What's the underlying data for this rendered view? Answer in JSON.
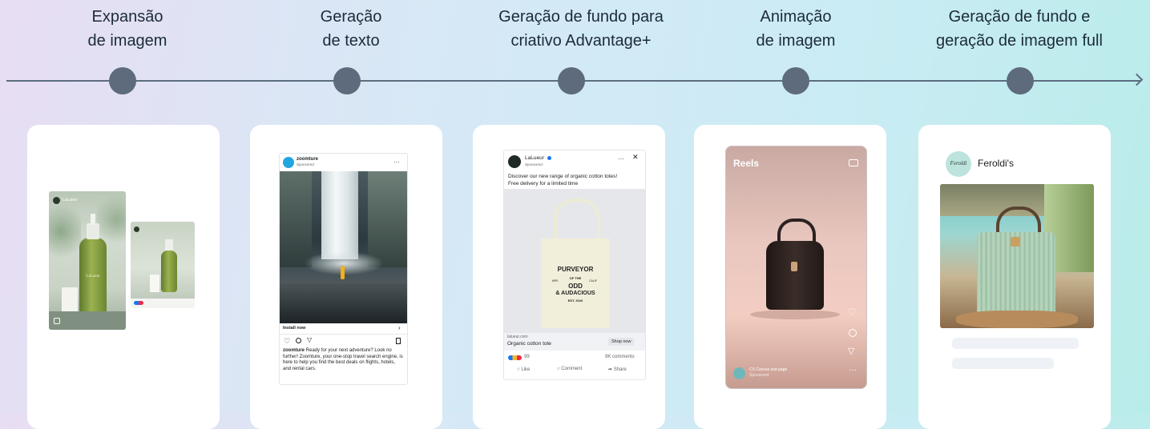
{
  "stages": [
    {
      "line1": "Expansão",
      "line2": "de imagem"
    },
    {
      "line1": "Geração",
      "line2": "de texto"
    },
    {
      "line1": "Geração de fundo para",
      "line2": "criativo Advantage+"
    },
    {
      "line1": "Animação",
      "line2": "de imagem"
    },
    {
      "line1": "Geração de fundo e",
      "line2": "geração de imagem full"
    }
  ],
  "card1": {
    "brand": "LaLueur",
    "bottle_label": "LaLueur"
  },
  "card2": {
    "brand": "zoomture",
    "sponsored": "Sponsored",
    "cta": "Install now",
    "caption_user": "zoomture",
    "caption": "Ready for your next adventure? Look no further! Zoomture, your one-stop travel search engine, is here to help you find the best deals on flights, hotels, and rental cars."
  },
  "card3": {
    "brand": "LaLueur",
    "sponsored": "Sponsored · ",
    "message_line1": "Discover our new range of organic cotton totes!",
    "message_line2": "Free delivery for a limited time",
    "tote_arc": "PURVEYOR",
    "tote_of": "OF THE",
    "tote_mpk": "MPK",
    "tote_calif": "CALIF",
    "tote_odd": "ODD",
    "tote_aud": "& AUDACIOUS",
    "tote_est": "EST. 2020",
    "domain": "lalueur.com",
    "headline": "Organic cotton tote",
    "cta": "Shop now",
    "reactions": "99",
    "comments": "9K comments",
    "like": "Like",
    "comment": "Comment",
    "share": "Share"
  },
  "card4": {
    "reels_label": "Reels",
    "page_name": "CS Canvas test page",
    "sponsored": "Sponsored"
  },
  "card5": {
    "brand_name": "Feroldi's",
    "logo_text": "Feroldi"
  }
}
